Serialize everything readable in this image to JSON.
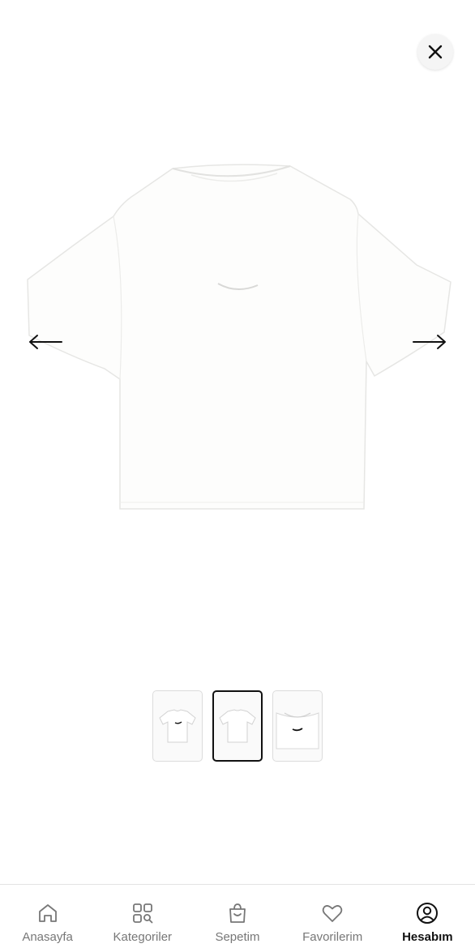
{
  "gallery": {
    "close_icon": "close-icon",
    "prev_icon": "arrow-left-icon",
    "next_icon": "arrow-right-icon",
    "thumbnail_count": 3,
    "active_thumbnail": 2
  },
  "bottom_nav": {
    "items": [
      {
        "label": "Anasayfa",
        "icon": "home-icon"
      },
      {
        "label": "Kategoriler",
        "icon": "categories-icon"
      },
      {
        "label": "Sepetim",
        "icon": "cart-icon"
      },
      {
        "label": "Favorilerim",
        "icon": "heart-icon"
      },
      {
        "label": "Hesabım",
        "icon": "account-icon"
      }
    ],
    "active_index": 4
  }
}
